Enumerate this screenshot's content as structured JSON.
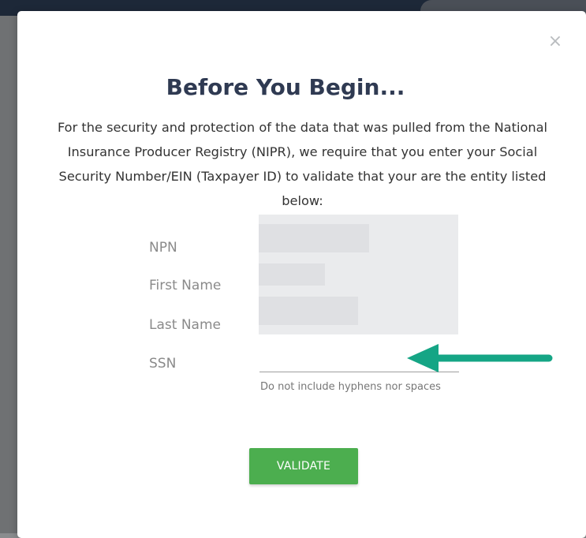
{
  "modal": {
    "close_icon": "×",
    "title": "Before You Begin...",
    "description": "For the security and protection of the data that was pulled from the National Insurance Producer Registry (NIPR), we require that you enter your Social Security Number/EIN (Taxpayer ID) to validate that your are the entity listed below:",
    "fields": {
      "npn_label": "NPN",
      "first_name_label": "First Name",
      "last_name_label": "Last Name",
      "ssn_label": "SSN",
      "ssn_value": "",
      "ssn_hint": "Do not include hyphens nor spaces"
    },
    "validate_label": "VALIDATE"
  },
  "colors": {
    "title": "#2f3a52",
    "button": "#4cae4f",
    "arrow": "#15a585",
    "redacted": "#e4e5e7"
  },
  "icons": {
    "close": "close-icon",
    "annotation": "arrow-left-icon"
  }
}
